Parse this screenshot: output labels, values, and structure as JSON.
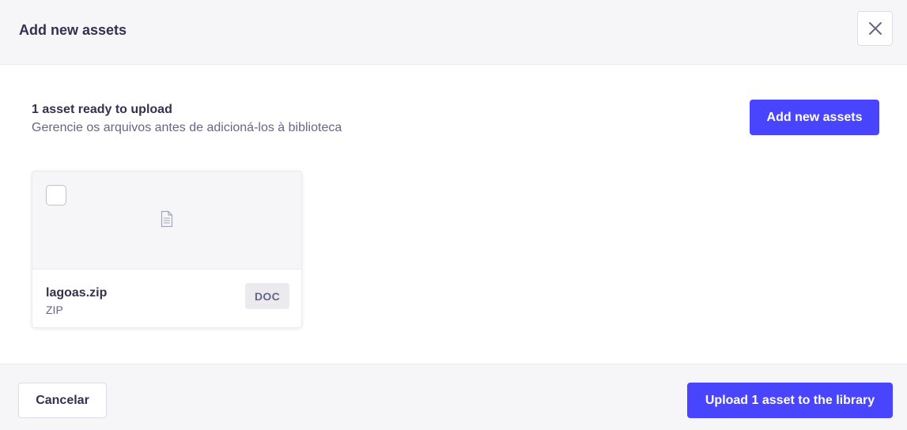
{
  "header": {
    "title": "Add new assets",
    "close_icon": "close-icon"
  },
  "summary": {
    "title": "1 asset ready to upload",
    "subtitle": "Gerencie os arquivos antes de adicioná-los à biblioteca",
    "add_button_label": "Add new assets"
  },
  "assets": [
    {
      "name": "lagoas.zip",
      "extension": "ZIP",
      "type_badge": "DOC",
      "selected": false,
      "preview_icon": "file-icon"
    }
  ],
  "footer": {
    "cancel_label": "Cancelar",
    "upload_label": "Upload 1 asset to the library"
  },
  "colors": {
    "primary": "#4945ff",
    "header_bg": "#f6f6f9",
    "text": "#32324d",
    "muted_text": "#666687",
    "border": "#dcdce4"
  }
}
